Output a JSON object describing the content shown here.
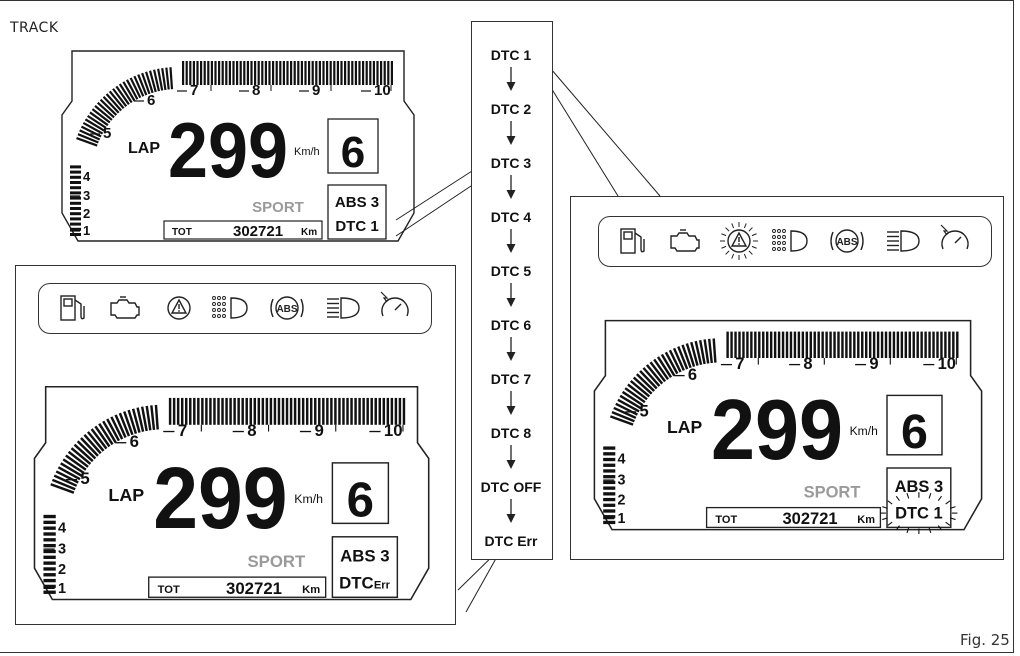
{
  "page": {
    "track_label": "TRACK",
    "figure_label": "Fig. 25"
  },
  "dtc_sequence": [
    "DTC  1",
    "DTC  2",
    "DTC  3",
    "DTC  4",
    "DTC  5",
    "DTC  6",
    "DTC  7",
    "DTC  8",
    "DTC OFF",
    "DTC Err"
  ],
  "dash": {
    "ticks": [
      "1",
      "2",
      "3",
      "4",
      "5",
      "6",
      "7",
      "8",
      "9",
      "10"
    ],
    "lap": "LAP",
    "speed": "299",
    "unit": "Km/h",
    "gear": "6",
    "mode": "SPORT",
    "odo_label": "TOT",
    "odo_value": "302721",
    "odo_unit": "Km",
    "abs": "ABS 3",
    "dtc_top": "DTC 1",
    "dtc_bottom_prefix": "DTC",
    "dtc_bottom_suffix": "Err"
  },
  "icons": [
    "fuel-icon",
    "engine-icon",
    "warning-icon",
    "parking-light-icon",
    "abs-icon",
    "high-beam-icon",
    "speed-limiter-icon"
  ],
  "colors": {
    "line": "#222222",
    "mode_gray": "#9a9a9a"
  }
}
